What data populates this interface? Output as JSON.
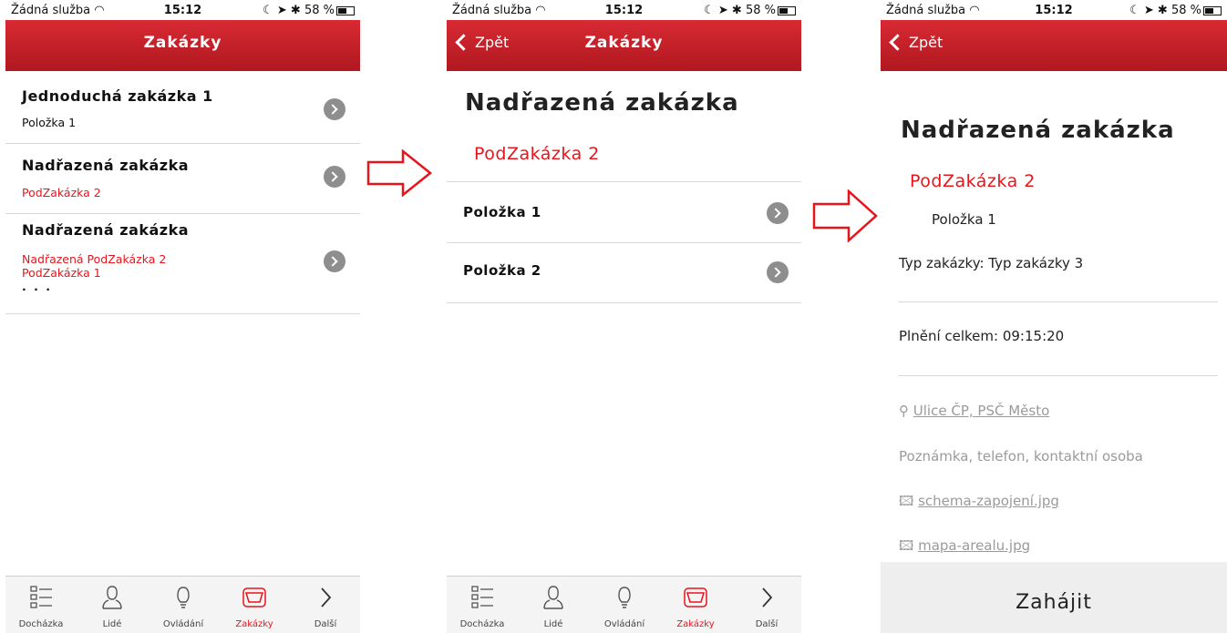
{
  "status": {
    "carrier": "Žádná služba",
    "time": "15:12",
    "battery": "58 %"
  },
  "screen1": {
    "title": "Zakázky",
    "rows": [
      {
        "title": "Jednoduchá zakázka 1",
        "subs": [
          "Položka 1"
        ],
        "red": false
      },
      {
        "title": "Nadřazená zakázka",
        "subs": [
          "PodZakázka 2"
        ],
        "red": true
      },
      {
        "title": "Nadřazená zakázka",
        "subs": [
          "Nadřazená PodZakázka 2",
          "PodZakázka 1",
          ". . ."
        ],
        "red": true
      }
    ]
  },
  "tabs": [
    {
      "label": "Docházka",
      "icon": "checklist-icon",
      "active": false
    },
    {
      "label": "Lidé",
      "icon": "person-icon",
      "active": false
    },
    {
      "label": "Ovládání",
      "icon": "lightbulb-icon",
      "active": false
    },
    {
      "label": "Zakázky",
      "icon": "inbox-icon",
      "active": true
    },
    {
      "label": "Další",
      "icon": "chevron-right-icon",
      "active": false
    }
  ],
  "screen2": {
    "back": "Zpět",
    "title": "Zakázky",
    "heading": "Nadřazená zakázka",
    "subheading": "PodZakázka 2",
    "items": [
      "Položka 1",
      "Položka 2"
    ]
  },
  "screen3": {
    "back": "Zpět",
    "heading": "Nadřazená zakázka",
    "subheading": "PodZakázka 2",
    "item": "Položka 1",
    "type": "Typ zakázky: Typ zakázky 3",
    "total": "Plnění celkem: 09:15:20",
    "address": "Ulice ČP, PSČ Město",
    "note": "Poznámka, telefon, kontaktní osoba",
    "attachments": [
      "schema-zapojení.jpg",
      "mapa-arealu.jpg"
    ],
    "start_label": "Zahájit"
  },
  "colors": {
    "accent": "#d82a33",
    "red_text": "#e8141b",
    "chevron": "#8e8e8e"
  }
}
